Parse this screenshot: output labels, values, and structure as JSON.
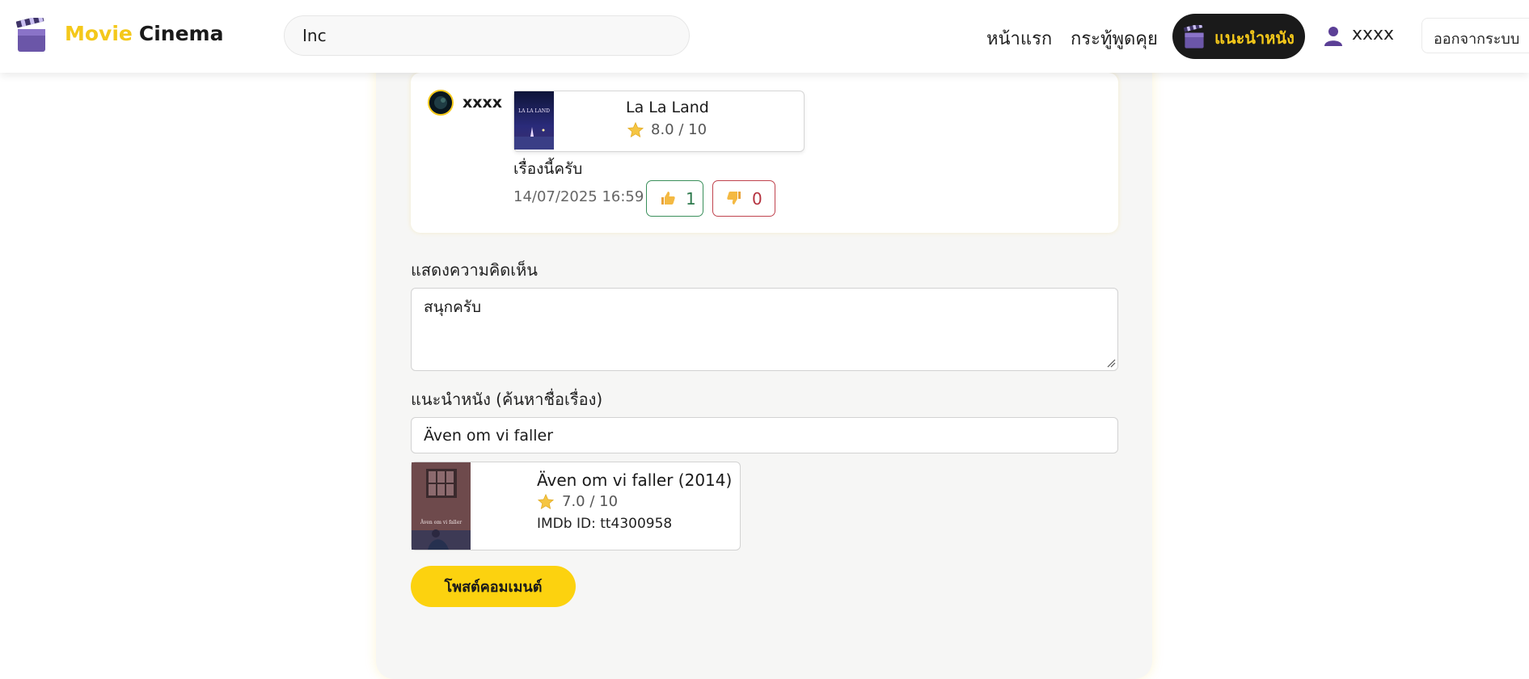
{
  "header": {
    "brand_first": "Movie",
    "brand_second": "Cinema",
    "search_value": "Inc",
    "nav": {
      "home": "หน้าแรก",
      "forum": "กระทู้พูดคุย",
      "recommend": "แนะนำหนัง"
    },
    "username": "xxxx",
    "logout": "ออกจากระบบ"
  },
  "comment": {
    "author": "xxxx",
    "movie": {
      "title": "La La Land",
      "rating": "8.0 / 10",
      "poster_text": "LA LA LAND"
    },
    "text": "เรื่องนี้ครับ",
    "timestamp": "14/07/2025 16:59",
    "likes": "1",
    "dislikes": "0"
  },
  "form": {
    "comment_label": "แสดงความคิดเห็น",
    "comment_value": "สนุกครับ",
    "recommend_label": "แนะนำหนัง (ค้นหาชื่อเรื่อง)",
    "movie_search_value": "Även om vi faller",
    "result": {
      "title": "Även om vi faller (2014)",
      "rating": "7.0 / 10",
      "imdb": "IMDb ID: tt4300958",
      "poster_text": "Även om vi faller"
    },
    "submit_label": "โพสต์คอมเมนต์"
  },
  "colors": {
    "accent": "#f4c81a",
    "like": "#3a8f5b",
    "dislike": "#c0434e"
  },
  "icons": [
    "clapperboard-icon",
    "user-icon",
    "star-icon",
    "thumbs-up-icon",
    "thumbs-down-icon"
  ]
}
